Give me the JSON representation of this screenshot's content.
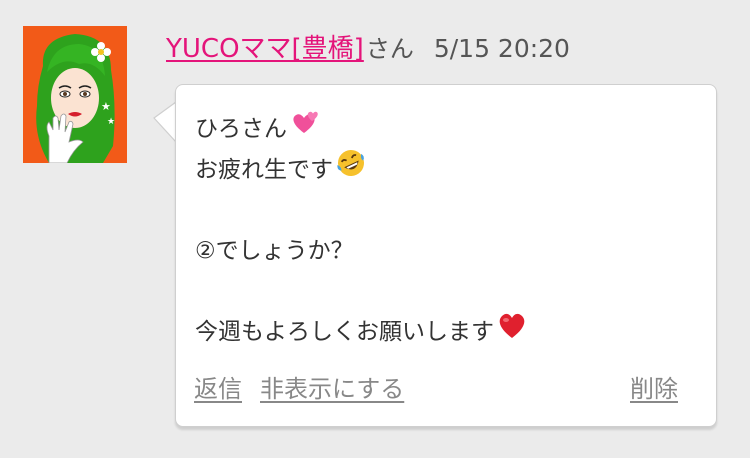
{
  "comment": {
    "author": {
      "name": "YUCOママ[豊橋]",
      "honorific": "さん"
    },
    "timestamp": "5/15 20:20",
    "message": {
      "lines": [
        "ひろさん",
        "お疲れ生です",
        "",
        "②でしょうか？",
        "",
        "今週もよろしくお願いします"
      ],
      "emojis": [
        "two-hearts-emoji",
        "rofl-emoji",
        "red-heart-emoji"
      ]
    },
    "actions": {
      "reply": "返信",
      "hide": "非表示にする",
      "delete": "削除"
    }
  },
  "colors": {
    "background": "#ebebeb",
    "author_link": "#e4147a",
    "meta_text": "#555555",
    "action_link": "#888888",
    "avatar_bg": "#f25a18"
  }
}
